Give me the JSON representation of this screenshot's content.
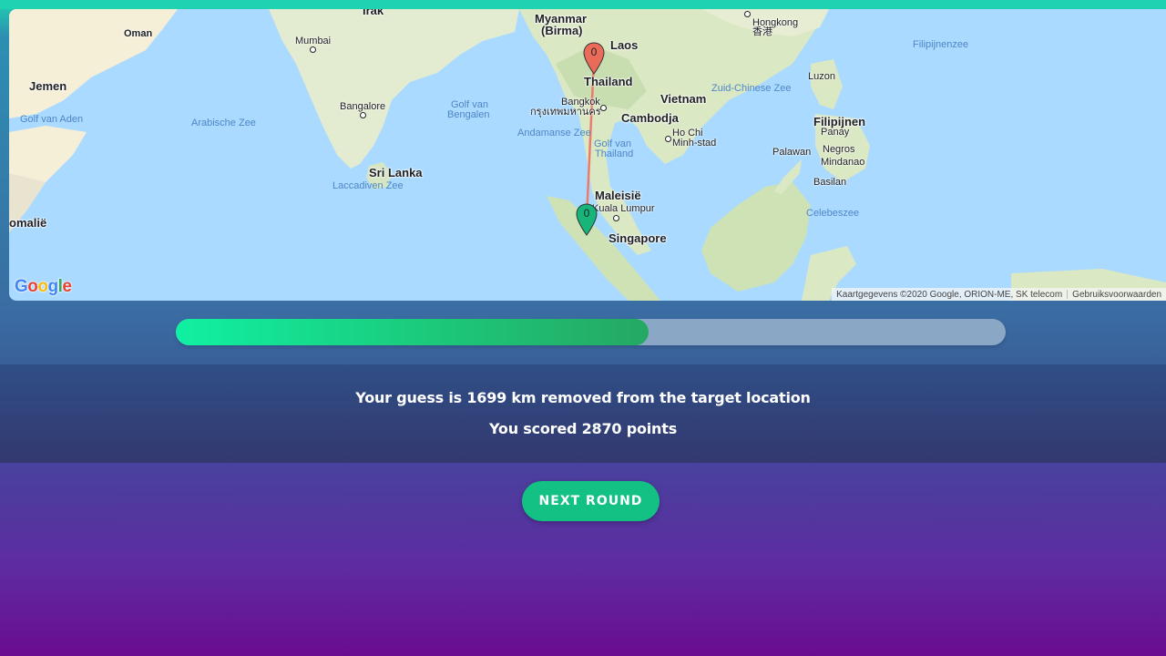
{
  "map": {
    "labels": {
      "irak": "Irak",
      "oman": "Oman",
      "jemen": "Jemen",
      "golf_van_aden": "Golf van Aden",
      "somalie": "omalië",
      "arabische_zee": "Arabische Zee",
      "mumbai": "Mumbai",
      "bangalore": "Bangalore",
      "sri_lanka": "Sri Lanka",
      "laccadiven_zee": "Laccadiven Zee",
      "golf_van_bengalen_1": "Golf van",
      "golf_van_bengalen_2": "Bengalen",
      "myanmar": "Myanmar",
      "birma": "(Birma)",
      "laos": "Laos",
      "thailand": "Thailand",
      "bangkok": "Bangkok",
      "bangkok_thai": "กรุงเทพมหานคร",
      "andamanse_zee": "Andamanse Zee",
      "golf_van_thailand_1": "Golf van",
      "golf_van_thailand_2": "Thailand",
      "cambodja": "Cambodja",
      "vietnam": "Vietnam",
      "ho_chi_minh_1": "Ho Chi",
      "ho_chi_minh_2": "Minh-stad",
      "hongkong": "Hongkong",
      "hongkong_cn": "香港",
      "zuid_chinese_zee": "Zuid-Chinese Zee",
      "filipijnenzee": "Filipijnenzee",
      "luzon": "Luzon",
      "filipijnen": "Filipijnen",
      "panay": "Panay",
      "negros": "Negros",
      "mindanao": "Mindanao",
      "palawan": "Palawan",
      "basilan": "Basilan",
      "celebeszee": "Celebeszee",
      "maleisie": "Maleisië",
      "kuala_lumpur": "Kuala Lumpur",
      "singapore": "Singapore"
    },
    "guess_marker_label": "0",
    "target_marker_label": "0",
    "guess_marker_color": "#ea6b5a",
    "target_marker_color": "#17b57a",
    "line_color": "#ec7b6e",
    "google_logo": [
      "G",
      "o",
      "o",
      "g",
      "l",
      "e"
    ],
    "attribution": "Kaartgegevens ©2020 Google, ORION-ME, SK telecom",
    "terms": "Gebruiksvoorwaarden"
  },
  "progress": {
    "score_fraction": 0.57,
    "fill_color": "#1cc87a"
  },
  "result": {
    "distance_text": "Your guess is 1699 km removed from the target location",
    "score_text": "You scored 2870 points"
  },
  "next_round_label": "NEXT ROUND"
}
